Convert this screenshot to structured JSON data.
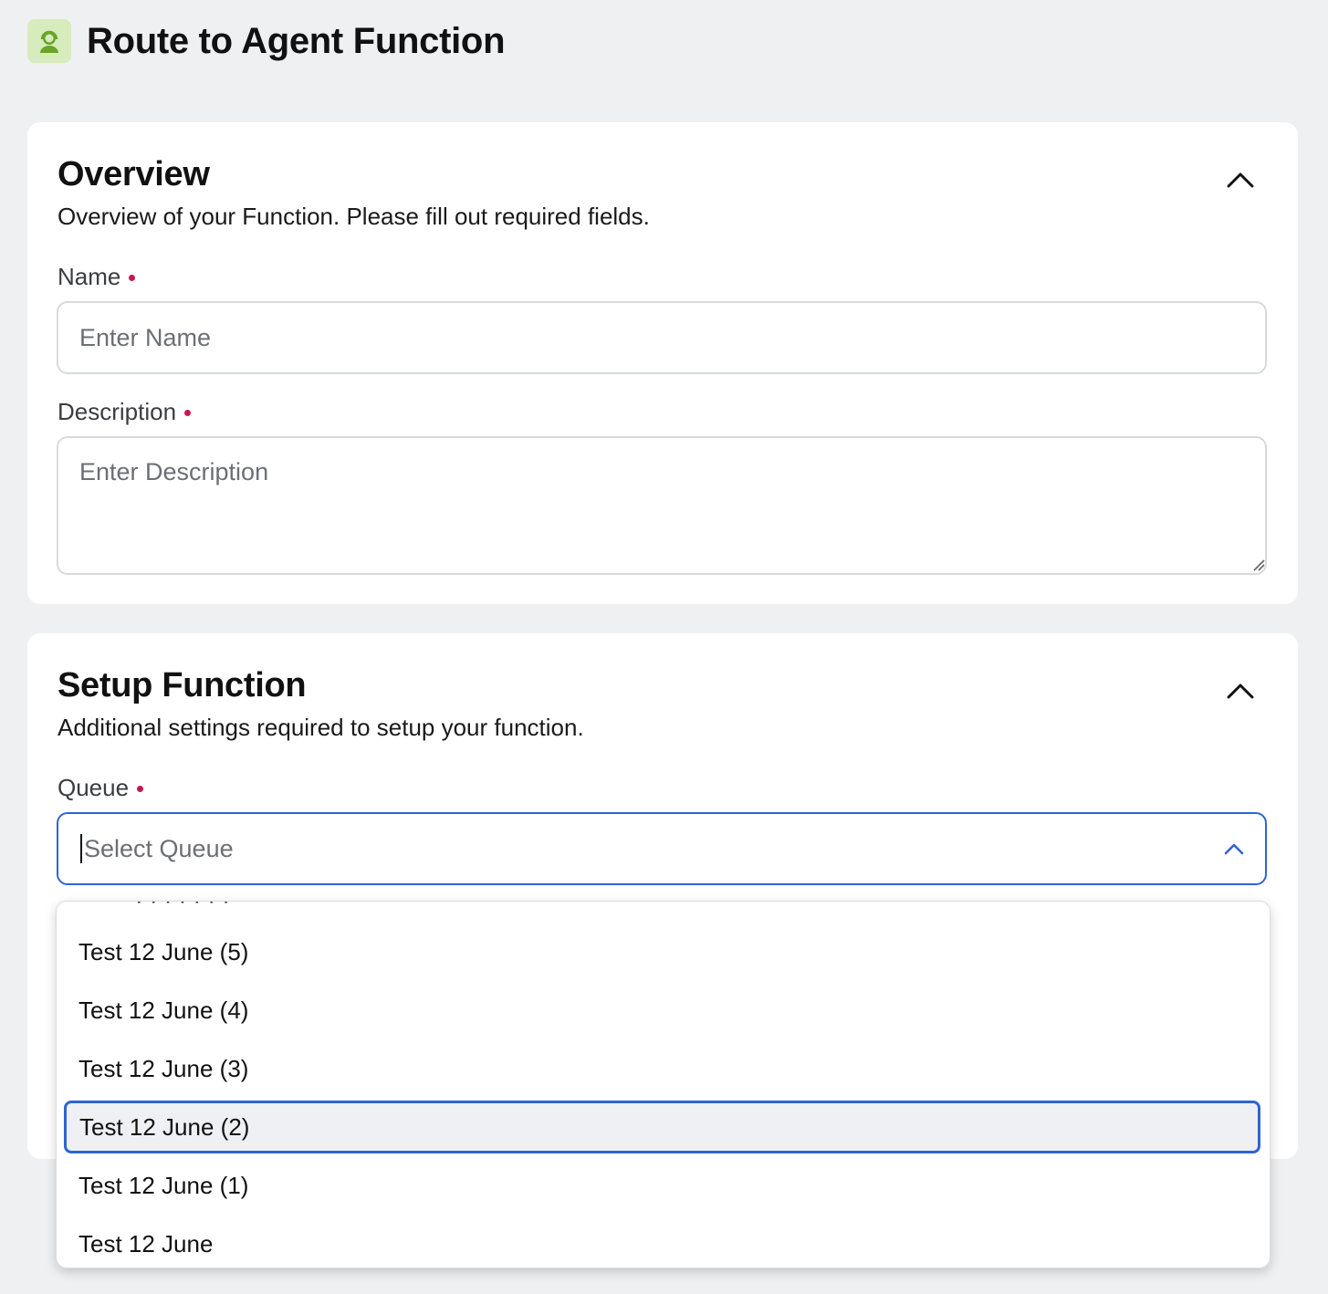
{
  "page": {
    "title": "Route to Agent Function",
    "icon": "agent-headset-icon",
    "accent_color": "#2d64d6",
    "required_color": "#c8174f"
  },
  "overview": {
    "title": "Overview",
    "subtitle": "Overview of your Function. Please fill out required fields.",
    "name_label": "Name",
    "name_placeholder": "Enter Name",
    "name_value": "",
    "description_label": "Description",
    "description_placeholder": "Enter Description",
    "description_value": ""
  },
  "setup": {
    "title": "Setup Function",
    "subtitle": "Additional settings required to setup your function.",
    "queue_label": "Queue",
    "queue_placeholder": "Select Queue",
    "queue_options": [
      "Test 12 June (5)",
      "Test 12 June (4)",
      "Test 12 June (3)",
      "Test 12 June (2)",
      "Test 12 June (1)",
      "Test 12 June"
    ],
    "highlighted_option": "Test 12 June (2)"
  }
}
